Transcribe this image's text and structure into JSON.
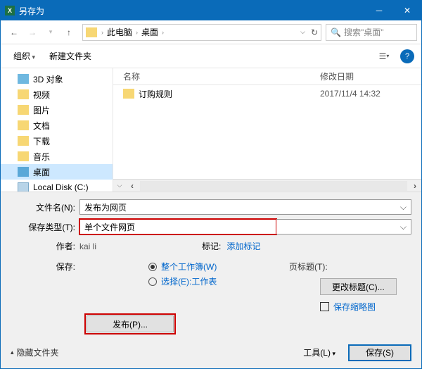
{
  "titlebar": {
    "title": "另存为",
    "app_icon_text": "X"
  },
  "nav": {
    "crumbs": [
      "此电脑",
      "桌面"
    ],
    "search_placeholder": "搜索\"桌面\""
  },
  "toolbar": {
    "organize": "组织",
    "new_folder": "新建文件夹",
    "help": "?"
  },
  "sidebar": {
    "items": [
      {
        "label": "3D 对象",
        "id": "3d"
      },
      {
        "label": "视频",
        "id": "videos"
      },
      {
        "label": "图片",
        "id": "pictures"
      },
      {
        "label": "文档",
        "id": "documents"
      },
      {
        "label": "下载",
        "id": "downloads"
      },
      {
        "label": "音乐",
        "id": "music"
      },
      {
        "label": "桌面",
        "id": "desktop",
        "selected": true
      },
      {
        "label": "Local Disk (C:)",
        "id": "cdrive",
        "disk": true
      }
    ]
  },
  "filelist": {
    "headers": {
      "name": "名称",
      "date": "修改日期"
    },
    "rows": [
      {
        "name": "订购规则",
        "date": "2017/11/4 14:32"
      }
    ]
  },
  "form": {
    "filename_label": "文件名(N):",
    "filename_value": "发布为网页",
    "filetype_label": "保存类型(T):",
    "filetype_value": "单个文件网页",
    "author_label": "作者:",
    "author_value": "kai li",
    "tags_label": "标记:",
    "tags_value": "添加标记",
    "save_label": "保存:",
    "radio_workbook": "整个工作簿(W)",
    "radio_sheet": "选择(E):工作表",
    "pagetitle_label": "页标题(T):",
    "change_title_btn": "更改标题(C)...",
    "publish_btn": "发布(P)...",
    "thumbnail_chk": "保存缩略图"
  },
  "footer": {
    "hide_folders": "隐藏文件夹",
    "tools": "工具(L)",
    "save": "保存(S)"
  }
}
